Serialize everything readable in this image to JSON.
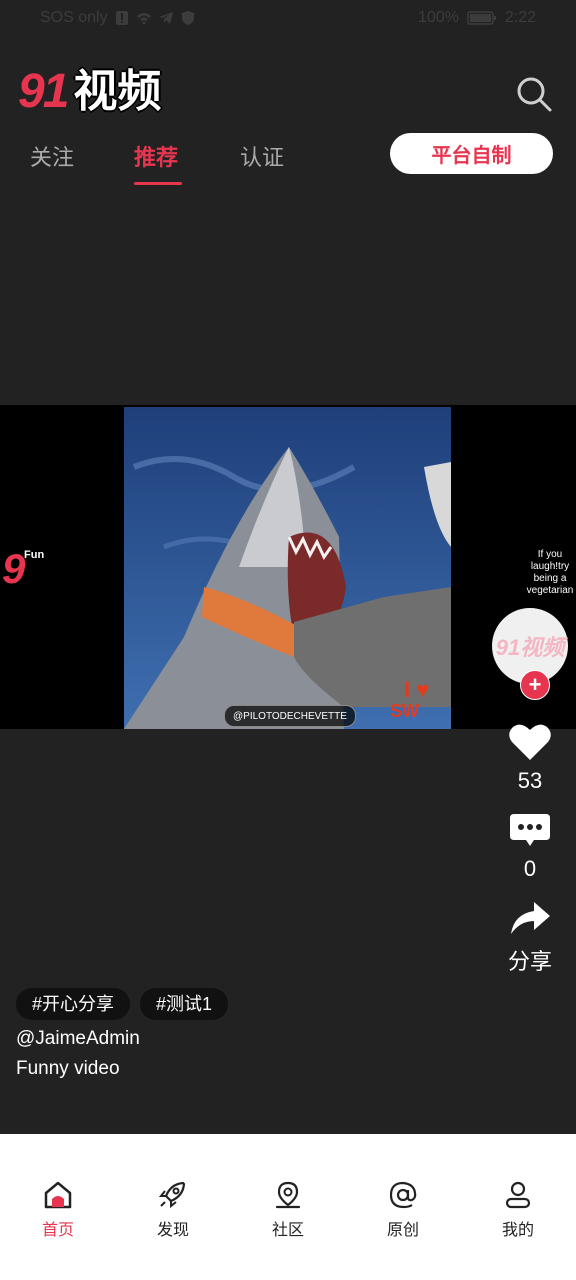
{
  "status_bar": {
    "left_text": "SOS only",
    "battery": "100%",
    "time": "2:22"
  },
  "header": {
    "logo_number": "91",
    "logo_text": "视频",
    "search_icon": "search-icon"
  },
  "tabs": [
    {
      "label": "关注"
    },
    {
      "label": "推荐"
    },
    {
      "label": "认证"
    }
  ],
  "platform_button": "平台自制",
  "video": {
    "watermark": "@PILOTODECHEVETTE",
    "left_brand": "9",
    "left_brand_suffix": "Fun",
    "right_caption": "If you laugh!try being a vegetarian"
  },
  "sidebar": {
    "avatar_text": "91视频",
    "follow_symbol": "+",
    "like_count": "53",
    "comment_count": "0",
    "share_label": "分享"
  },
  "post": {
    "hashtags": [
      "#开心分享",
      "#测试1"
    ],
    "author": "@JaimeAdmin",
    "description": "Funny video"
  },
  "bottom_nav": [
    {
      "label": "首页",
      "icon": "home-icon",
      "active": true
    },
    {
      "label": "发现",
      "icon": "rocket-icon"
    },
    {
      "label": "社区",
      "icon": "location-pin-icon"
    },
    {
      "label": "原创",
      "icon": "at-sign-icon"
    },
    {
      "label": "我的",
      "icon": "user-icon"
    }
  ],
  "colors": {
    "accent": "#e8354f",
    "background": "#222222"
  }
}
